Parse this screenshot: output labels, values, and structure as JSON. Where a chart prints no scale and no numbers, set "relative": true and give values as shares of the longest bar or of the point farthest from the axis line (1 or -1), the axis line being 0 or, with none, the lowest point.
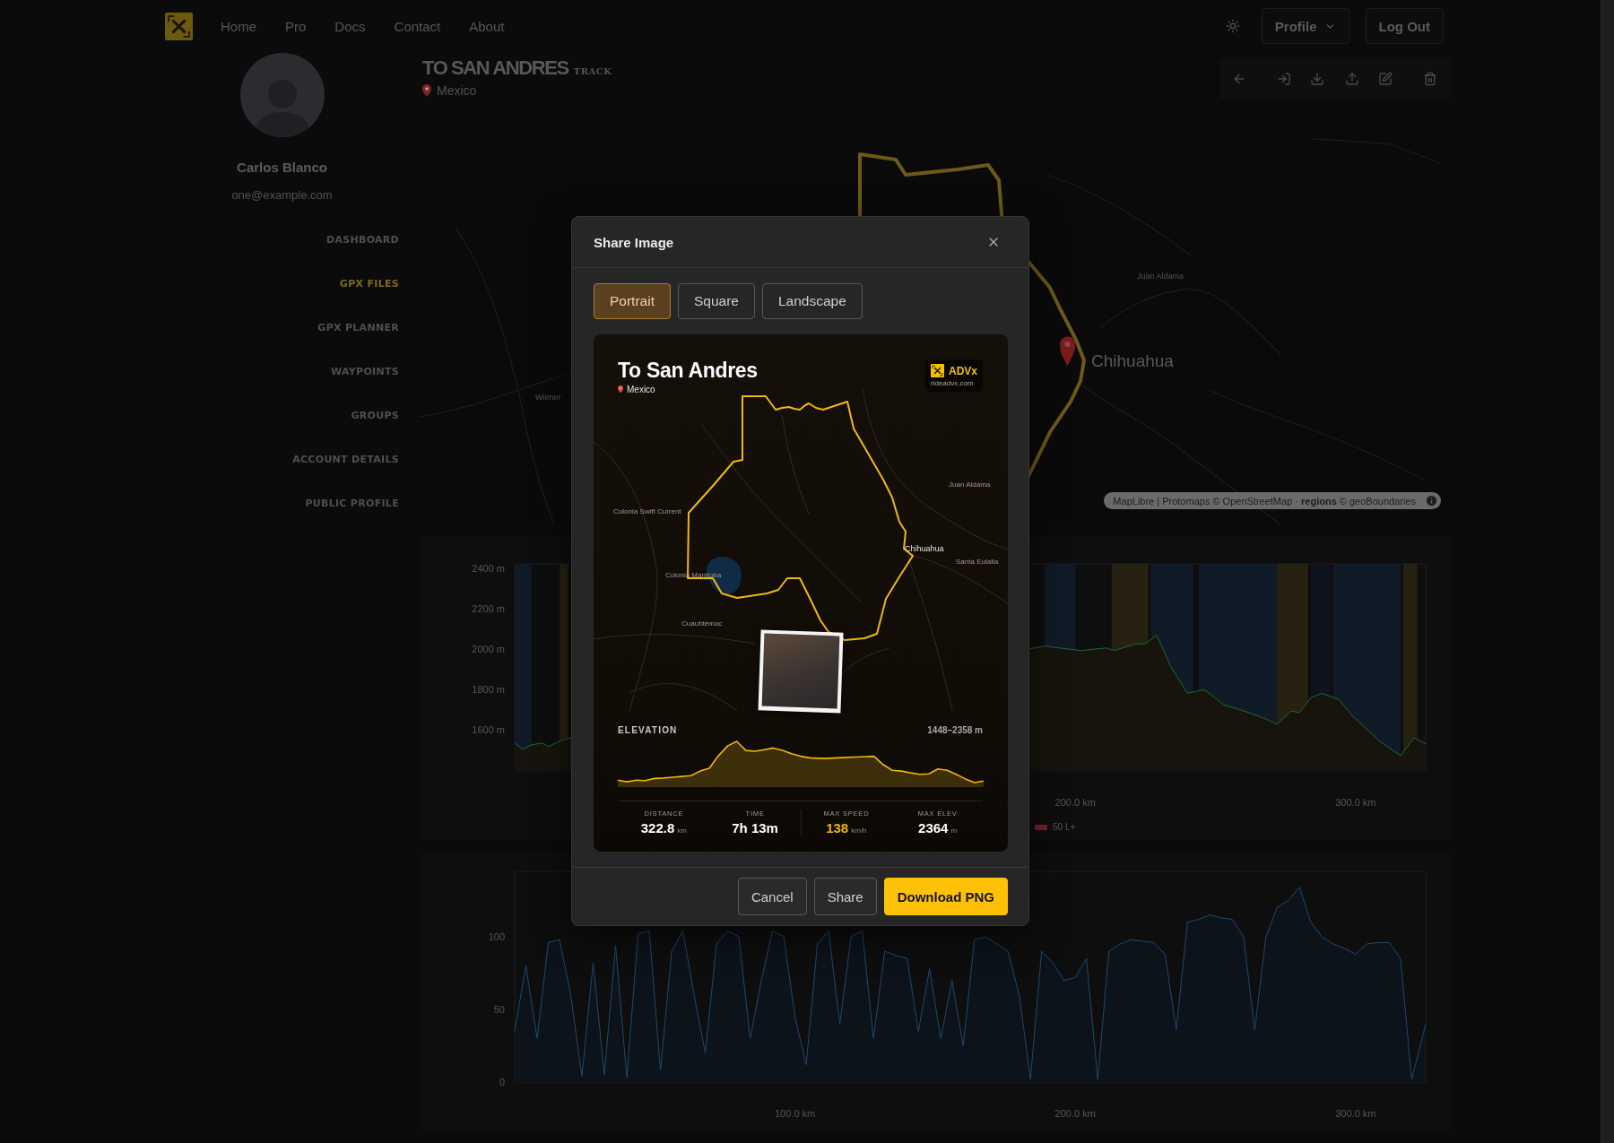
{
  "nav": {
    "links": [
      {
        "label": "Home"
      },
      {
        "label": "Pro"
      },
      {
        "label": "Docs"
      },
      {
        "label": "Contact"
      },
      {
        "label": "About"
      }
    ],
    "profile": {
      "label": "Profile"
    },
    "logout": {
      "label": "Log Out"
    }
  },
  "sidebar": {
    "user": {
      "name": "Carlos Blanco",
      "email": "one@example.com"
    },
    "items": [
      {
        "label": "DASHBOARD",
        "selected": false
      },
      {
        "label": "GPX FILES",
        "selected": true
      },
      {
        "label": "GPX PLANNER",
        "selected": false
      },
      {
        "label": "WAYPOINTS",
        "selected": false
      },
      {
        "label": "GROUPS",
        "selected": false
      },
      {
        "label": "ACCOUNT DETAILS",
        "selected": false
      },
      {
        "label": "PUBLIC PROFILE",
        "selected": false
      }
    ]
  },
  "track": {
    "title": "TO SAN ANDRES",
    "type_label": "TRACK",
    "location": "Mexico"
  },
  "map": {
    "labels": [
      {
        "text": "Wiener",
        "kind": "town"
      },
      {
        "text": "Juan Aldama",
        "kind": "town"
      },
      {
        "text": "Chihuahua",
        "kind": "city"
      }
    ],
    "attribution": "MapLibre | Protomaps © OpenStreetMap · **regions** © geoBoundaries"
  },
  "elevation_panel": {
    "chart_data": {
      "type": "area",
      "x": [
        0,
        3,
        6,
        10,
        12,
        16,
        19,
        184,
        189,
        202,
        211,
        214,
        221,
        225,
        229,
        231,
        234,
        240,
        246,
        253,
        262,
        268,
        272,
        277,
        280,
        284,
        288,
        294,
        299,
        309,
        316,
        321,
        325
      ],
      "series": [
        {
          "color": "#1c6a35",
          "values": [
            1534,
            1503,
            1525,
            1534,
            1516,
            1543,
            1556,
            2000,
            2013,
            1991,
            2004,
            1991,
            2022,
            2026,
            2066,
            2009,
            1912,
            1780,
            1798,
            1723,
            1684,
            1653,
            1626,
            1692,
            1684,
            1758,
            1780,
            1749,
            1666,
            1538,
            1472,
            1560,
            1530
          ]
        }
      ],
      "xlim": [
        0,
        325
      ],
      "ylim": [
        1400,
        2420
      ],
      "xticks": [
        {
          "value": 200,
          "label": "200.0 km"
        },
        {
          "value": 300,
          "label": "300.0 km"
        }
      ],
      "yticks": [
        {
          "value": 1600,
          "label": "1600 m"
        },
        {
          "value": 1800,
          "label": "1800 m"
        },
        {
          "value": 2000,
          "label": "2000 m"
        },
        {
          "value": 2200,
          "label": "2200 m"
        },
        {
          "value": 2400,
          "label": "2400 m"
        }
      ],
      "bands": [
        {
          "axis": "x",
          "from": 0,
          "to": 6,
          "color": "#111a27"
        },
        {
          "axis": "x",
          "from": 16,
          "to": 19,
          "color": "#272111"
        },
        {
          "axis": "x",
          "from": 189,
          "to": 200,
          "color": "#111a27"
        },
        {
          "axis": "x",
          "from": 213,
          "to": 226,
          "color": "#272111"
        },
        {
          "axis": "x",
          "from": 227,
          "to": 242,
          "color": "#111a27"
        },
        {
          "axis": "x",
          "from": 244,
          "to": 272,
          "color": "#111a27"
        },
        {
          "axis": "x",
          "from": 272,
          "to": 283,
          "color": "#272111"
        },
        {
          "axis": "x",
          "from": 284,
          "to": 291,
          "color": "#0e141e"
        },
        {
          "axis": "x",
          "from": 292,
          "to": 316,
          "color": "#111a27"
        },
        {
          "axis": "x",
          "from": 317,
          "to": 322,
          "color": "#272111"
        }
      ]
    },
    "legend": [
      {
        "label": "50 L+",
        "color": "#7a1f2e"
      }
    ]
  },
  "speed_panel": {
    "chart_data": {
      "type": "area",
      "x": [
        0,
        4,
        8,
        12,
        16,
        20,
        24,
        28,
        32,
        36,
        40,
        44,
        48,
        52,
        56,
        60,
        64,
        68,
        72,
        76,
        80,
        84,
        88,
        92,
        96,
        100,
        104,
        108,
        112,
        116,
        120,
        124,
        128,
        132,
        136,
        140,
        144,
        148,
        152,
        156,
        160,
        164,
        168,
        172,
        176,
        180,
        184,
        188,
        192,
        196,
        200,
        204,
        208,
        212,
        216,
        220,
        224,
        228,
        232,
        236,
        240,
        244,
        248,
        252,
        256,
        260,
        264,
        268,
        272,
        276,
        280,
        284,
        288,
        292,
        296,
        300,
        304,
        308,
        312,
        316,
        320,
        325
      ],
      "series": [
        {
          "color": "#1d4a70",
          "values": [
            35,
            80,
            30,
            96,
            98,
            60,
            4,
            82,
            5,
            94,
            3,
            102,
            104,
            8,
            90,
            104,
            60,
            20,
            95,
            104,
            100,
            30,
            70,
            104,
            100,
            45,
            12,
            95,
            104,
            40,
            100,
            104,
            30,
            90,
            87,
            85,
            35,
            78,
            30,
            70,
            25,
            98,
            100,
            95,
            90,
            60,
            2,
            90,
            82,
            70,
            72,
            85,
            2,
            90,
            95,
            98,
            97,
            96,
            88,
            36,
            110,
            112,
            115,
            113,
            112,
            100,
            36,
            100,
            120,
            125,
            134,
            110,
            100,
            95,
            92,
            88,
            95,
            96,
            96,
            85,
            2,
            40
          ]
        }
      ],
      "xlim": [
        0,
        325
      ],
      "ylim": [
        0,
        145
      ],
      "xticks": [
        {
          "value": 100,
          "label": "100.0 km"
        },
        {
          "value": 200,
          "label": "200.0 km"
        },
        {
          "value": 300,
          "label": "300.0 km"
        }
      ],
      "yticks": [
        0,
        50,
        100
      ]
    }
  },
  "dialog": {
    "title": "Share Image",
    "formats": [
      {
        "label": "Portrait",
        "selected": true
      },
      {
        "label": "Square",
        "selected": false
      },
      {
        "label": "Landscape",
        "selected": false
      }
    ],
    "preview": {
      "title": "To San Andres",
      "location": "Mexico",
      "brand": {
        "name": "ADVx",
        "site": "rideadvx.com"
      },
      "map_labels": [
        {
          "text": "Colonia Swift Current",
          "kind": "town"
        },
        {
          "text": "Colonia Manitoba",
          "kind": "town"
        },
        {
          "text": "Cuauhtémoc",
          "kind": "town"
        },
        {
          "text": "Juan Aldama",
          "kind": "town"
        },
        {
          "text": "Chihuahua",
          "kind": "city"
        },
        {
          "text": "Santa Eulalia",
          "kind": "town"
        }
      ],
      "elevation": {
        "label": "ELEVATION",
        "range": "1448–2358 m",
        "chart_data": {
          "type": "area",
          "relative": true,
          "categories": [
            null,
            null,
            null,
            null,
            null,
            null,
            null,
            null,
            null,
            null,
            null,
            null,
            null,
            null,
            null,
            null,
            null,
            null,
            null,
            null,
            null,
            null,
            null,
            null,
            null,
            null,
            null,
            null,
            null,
            null,
            null,
            null,
            null,
            null,
            null,
            null,
            null,
            null,
            null,
            null,
            null
          ],
          "series": [
            {
              "color": "#f2b705",
              "values": [
                0.06,
                0.02,
                0.06,
                0.05,
                0.1,
                0.11,
                0.13,
                0.15,
                0.17,
                0.28,
                0.35,
                0.65,
                0.89,
                1,
                0.78,
                0.76,
                0.8,
                0.84,
                0.78,
                0.7,
                0.64,
                0.6,
                0.59,
                0.59,
                0.6,
                0.61,
                0.62,
                0.63,
                0.64,
                0.44,
                0.3,
                0.28,
                0.24,
                0.2,
                0.21,
                0.33,
                0.3,
                0.2,
                0.09,
                0,
                0.04
              ]
            }
          ]
        }
      },
      "stats": [
        {
          "label": "DISTANCE",
          "value": "322.8",
          "unit": "km",
          "highlighted": false
        },
        {
          "label": "TIME",
          "value": "7h 13m",
          "highlighted": false
        },
        {
          "label": "MAX SPEED",
          "value": "138",
          "unit": "km/h",
          "highlighted": true
        },
        {
          "label": "MAX ELEV",
          "value": "2364",
          "unit": "m",
          "highlighted": false
        }
      ]
    },
    "buttons": [
      {
        "label": "Cancel",
        "kind": "secondary"
      },
      {
        "label": "Share",
        "kind": "secondary"
      },
      {
        "label": "Download PNG",
        "kind": "primary"
      }
    ]
  }
}
